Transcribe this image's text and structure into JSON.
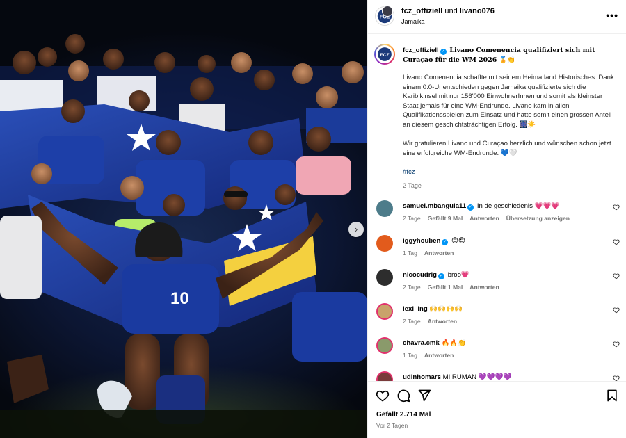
{
  "header": {
    "user1": "fcz_offiziell",
    "und": "und",
    "user2": "livano076",
    "location": "Jamaika",
    "more_icon": "more-horizontal-icon"
  },
  "photo": {
    "jersey_number": "10",
    "next_icon": "chevron-right-icon"
  },
  "caption": {
    "username": "fcz_offiziell",
    "headline": "Livano Comenencia qualifiziert sich mit Curaçao für die WM 2026 🏅👏",
    "body": "Livano Comenencia schaffte mit seinem Heimatland Historisches. Dank einem 0:0-Unentschieden gegen Jamaika qualifizierte sich die Karibikinsel mit nur 156'000 EinwohnerInnen und somit als kleinster Staat jemals für eine WM-Endrunde. Livano kam in allen Qualifikationsspielen zum Einsatz und hatte somit einen grossen Anteil an diesem geschichtsträchtigen Erfolg. 🎆☀️",
    "body2": "Wir gratulieren Livano und Curaçao herzlich und wünschen schon jetzt eine erfolgreiche WM-Endrunde. 💙🤍",
    "hashtag": "#fcz",
    "age": "2 Tage"
  },
  "comments": [
    {
      "user": "samuel.mbangula11",
      "verified": true,
      "text": "In de geschiedenis 💗💗💗",
      "age": "2 Tage",
      "likes": "Gefällt 9 Mal",
      "reply": "Antworten",
      "translate": "Übersetzung anzeigen",
      "avatar_color": "#4d7c8a"
    },
    {
      "user": "iggyhouben",
      "verified": true,
      "text": "😍😍",
      "age": "1 Tag",
      "likes": "",
      "reply": "Antworten",
      "translate": "",
      "avatar_color": "#e25b1c"
    },
    {
      "user": "nicocudrig",
      "verified": true,
      "text": "broo💗",
      "age": "2 Tage",
      "likes": "Gefällt 1 Mal",
      "reply": "Antworten",
      "translate": "",
      "avatar_color": "#2d2d2d"
    },
    {
      "user": "lexi_ing",
      "verified": false,
      "text": "🙌🙌🙌🙌",
      "age": "2 Tage",
      "likes": "",
      "reply": "Antworten",
      "translate": "",
      "avatar_color": "#c9a36b"
    },
    {
      "user": "chavra.cmk",
      "verified": false,
      "text": "🔥🔥👏",
      "age": "1 Tag",
      "likes": "",
      "reply": "Antworten",
      "translate": "",
      "avatar_color": "#8a9a6b"
    },
    {
      "user": "udinhomars",
      "verified": false,
      "text": "MI RUMAN 💜💜💜💜",
      "age": "",
      "likes": "",
      "reply": "",
      "translate": "",
      "avatar_color": "#7a3b3b"
    }
  ],
  "actions": {
    "like_icon": "heart-icon",
    "comment_icon": "comment-icon",
    "share_icon": "send-icon",
    "save_icon": "bookmark-icon",
    "likes": "Gefällt 2.714 Mal",
    "ago": "Vor 2 Tagen"
  },
  "colors": {
    "link": "#00376b",
    "verified": "#0095f6",
    "secondary": "#737373"
  }
}
